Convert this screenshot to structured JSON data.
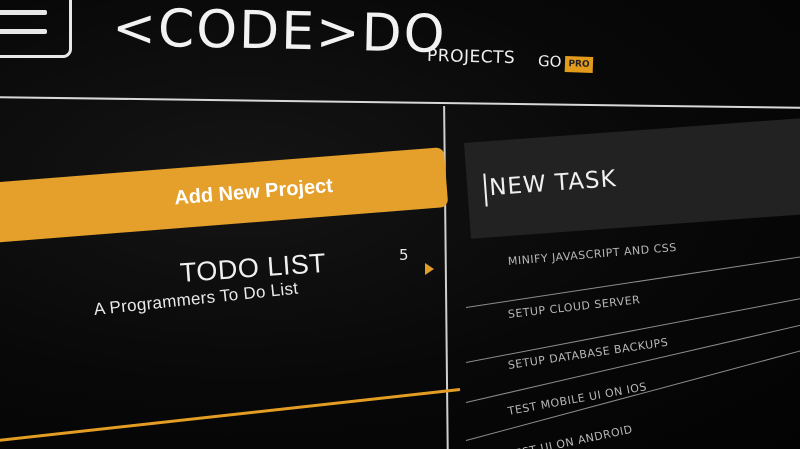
{
  "header": {
    "logo": "<CODE>DO",
    "nav": {
      "projects": "PROJECTS",
      "go": "GO",
      "pro_badge": "PRO"
    }
  },
  "projects": {
    "add_button": "Add New Project",
    "items": [
      {
        "title": "TODO LIST",
        "subtitle": "A Programmers To Do List",
        "count": "5"
      }
    ]
  },
  "tasks": {
    "new_task_placeholder": "NEW TASK",
    "items": [
      "MINIFY JAVASCRIPT AND CSS",
      "SETUP CLOUD SERVER",
      "SETUP DATABASE BACKUPS",
      "TEST MOBILE UI ON IOS",
      "TEST UI ON ANDROID"
    ]
  },
  "colors": {
    "accent": "#e4a02b",
    "background": "#060606",
    "text": "#f0f0f0",
    "task_input_bg": "#222222"
  },
  "icons": {
    "menu": "hamburger-menu-icon",
    "expand": "triangle-right-icon"
  }
}
